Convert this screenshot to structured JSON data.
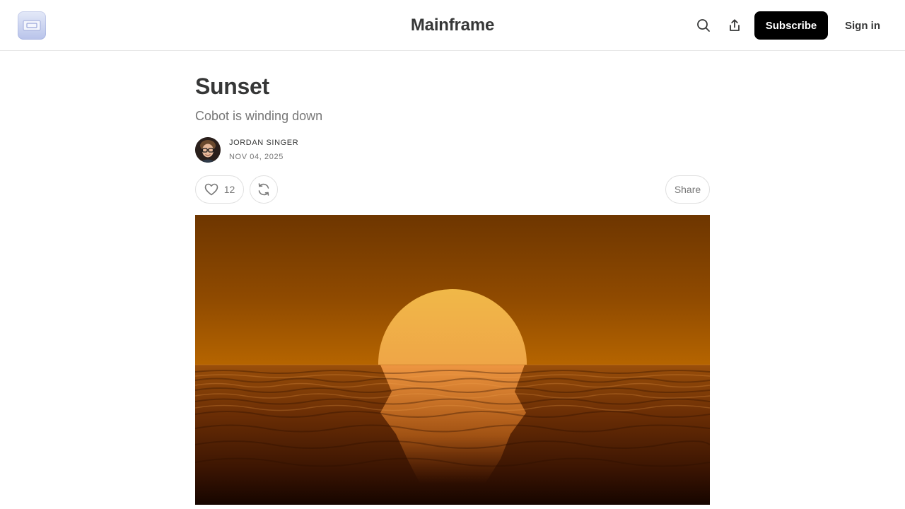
{
  "header": {
    "site_title": "Mainframe",
    "logo_icon": "mainframe-logo-icon",
    "search_icon": "search-icon",
    "share_icon": "upload-share-icon",
    "subscribe_label": "Subscribe",
    "signin_label": "Sign in"
  },
  "post": {
    "title": "Sunset",
    "subtitle": "Cobot is winding down",
    "author": "JORDAN SINGER",
    "date": "NOV 04, 2025",
    "like_count": "12",
    "share_label": "Share",
    "hero_image": "sunset-over-water"
  },
  "colors": {
    "accent_button": "#000000",
    "text_primary": "#363737",
    "text_secondary": "#777777",
    "sky_top": "#6e3600",
    "sky_horizon": "#b26100",
    "sun": "#ee9a45",
    "water_dark": "#1e0800"
  }
}
